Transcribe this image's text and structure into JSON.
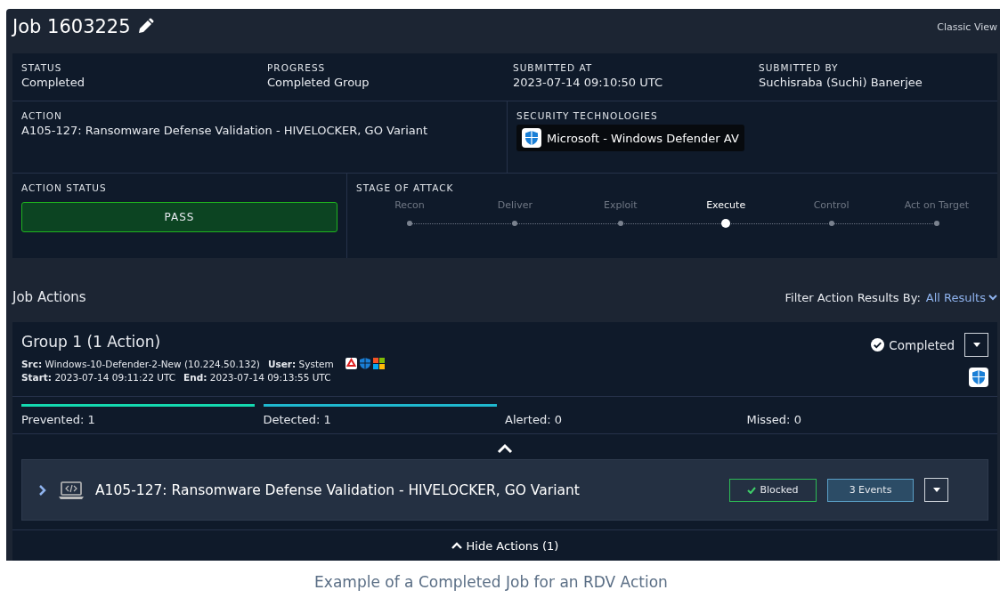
{
  "job": {
    "title": "Job 1603225",
    "classic_view": "Classic View"
  },
  "summary": [
    {
      "label": "STATUS",
      "value": "Completed"
    },
    {
      "label": "PROGRESS",
      "value": "Completed Group"
    },
    {
      "label": "SUBMITTED AT",
      "value": "2023-07-14 09:10:50 UTC"
    },
    {
      "label": "SUBMITTED BY",
      "value": "Suchisraba (Suchi) Banerjee"
    }
  ],
  "action": {
    "label": "ACTION",
    "value": "A105-127: Ransomware Defense Validation - HIVELOCKER, GO Variant"
  },
  "security_technologies": {
    "label": "SECURITY TECHNOLOGIES",
    "items": [
      "Microsoft - Windows Defender AV"
    ]
  },
  "action_status": {
    "label": "ACTION STATUS",
    "value": "PASS"
  },
  "stage_of_attack": {
    "label": "STAGE OF ATTACK",
    "stages": [
      {
        "name": "Recon",
        "selected": false
      },
      {
        "name": "Deliver",
        "selected": false
      },
      {
        "name": "Exploit",
        "selected": false
      },
      {
        "name": "Execute",
        "selected": true
      },
      {
        "name": "Control",
        "selected": false
      },
      {
        "name": "Act on Target",
        "selected": false
      }
    ]
  },
  "job_actions": {
    "title": "Job Actions",
    "filter_label": "Filter Action Results By:",
    "filter_value": "All Results"
  },
  "group": {
    "title": "Group 1 (1 Action)",
    "status": "Completed",
    "src_label": "Src:",
    "src": "Windows-10-Defender-2-New (10.224.50.132)",
    "user_label": "User:",
    "user": "System",
    "start_label": "Start:",
    "start": "2023-07-14 09:11:22 UTC",
    "end_label": "End:",
    "end": "2023-07-14 09:13:55 UTC",
    "counts": [
      {
        "label": "Prevented: 1",
        "bar": true,
        "color": "#14d9b0"
      },
      {
        "label": "Detected: 1",
        "bar": true,
        "color": "#1fb8cf"
      },
      {
        "label": "Alerted: 0",
        "bar": false
      },
      {
        "label": "Missed: 0",
        "bar": false
      }
    ],
    "actions": [
      {
        "title": "A105-127: Ransomware Defense Validation - HIVELOCKER, GO Variant",
        "result": "Blocked",
        "events": "3 Events"
      }
    ],
    "hide_actions": "Hide Actions (1)"
  },
  "caption": "Example of a Completed Job for an RDV Action"
}
